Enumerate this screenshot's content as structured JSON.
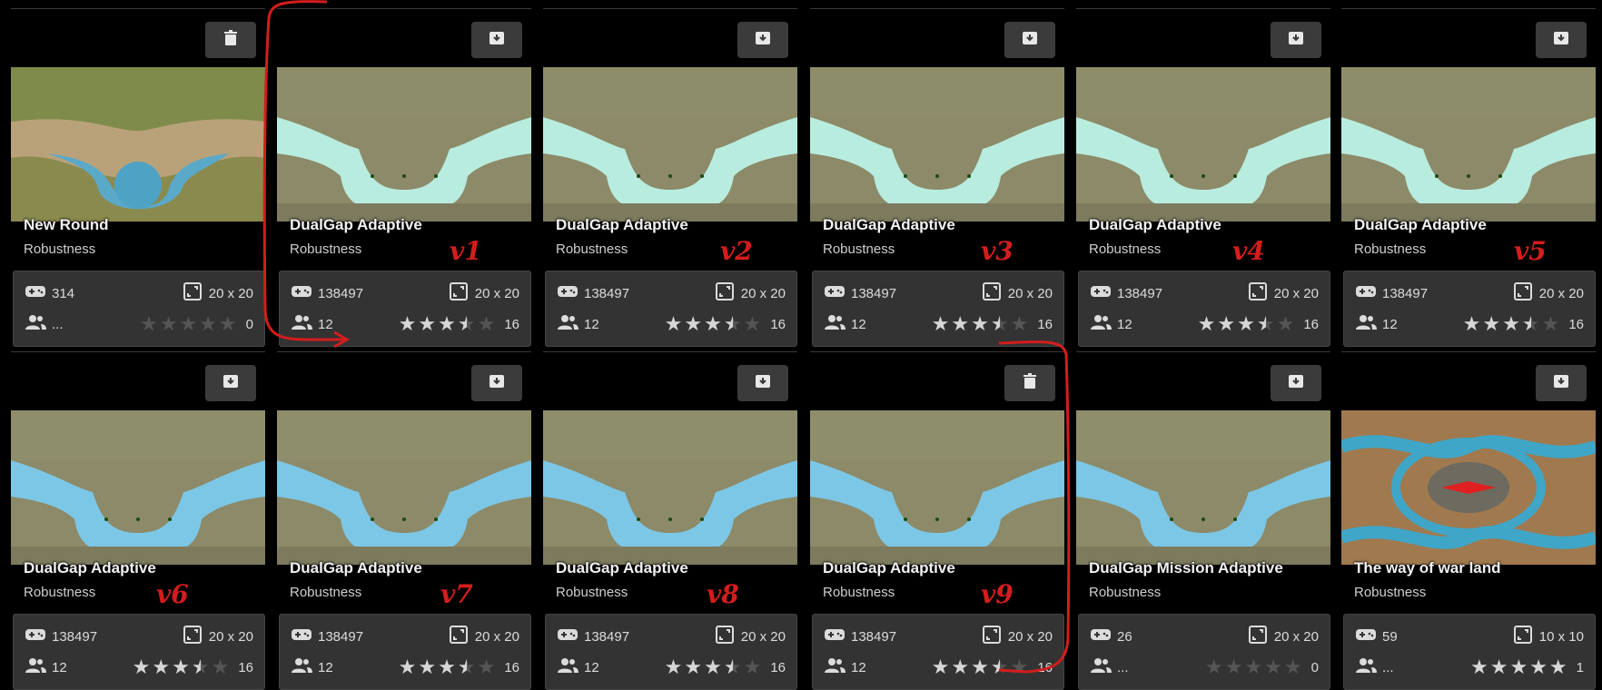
{
  "colors": {
    "page_bg": "#000000",
    "card_stats_bg": "#333333",
    "button_bg": "#3b3b3b",
    "annotation_red": "#d41d1d",
    "star_filled": "#d6d6d6",
    "star_empty": "#555555"
  },
  "cards": [
    {
      "title": "New Round",
      "subtitle": "Robustness",
      "plays": "314",
      "size": "20 x 20",
      "players": "...",
      "stars": 0,
      "rating_count": "0",
      "action": "delete",
      "version": "",
      "map": "sand"
    },
    {
      "title": "DualGap Adaptive",
      "subtitle": "Robustness",
      "plays": "138497",
      "size": "20 x 20",
      "players": "12",
      "stars": 3.5,
      "rating_count": "16",
      "action": "download",
      "version": "v1",
      "map": "river"
    },
    {
      "title": "DualGap Adaptive",
      "subtitle": "Robustness",
      "plays": "138497",
      "size": "20 x 20",
      "players": "12",
      "stars": 3.5,
      "rating_count": "16",
      "action": "download",
      "version": "v2",
      "map": "river"
    },
    {
      "title": "DualGap Adaptive",
      "subtitle": "Robustness",
      "plays": "138497",
      "size": "20 x 20",
      "players": "12",
      "stars": 3.5,
      "rating_count": "16",
      "action": "download",
      "version": "v3",
      "map": "river"
    },
    {
      "title": "DualGap Adaptive",
      "subtitle": "Robustness",
      "plays": "138497",
      "size": "20 x 20",
      "players": "12",
      "stars": 3.5,
      "rating_count": "16",
      "action": "download",
      "version": "v4",
      "map": "river"
    },
    {
      "title": "DualGap Adaptive",
      "subtitle": "Robustness",
      "plays": "138497",
      "size": "20 x 20",
      "players": "12",
      "stars": 3.5,
      "rating_count": "16",
      "action": "download",
      "version": "v5",
      "map": "river"
    },
    {
      "title": "DualGap Adaptive",
      "subtitle": "Robustness",
      "plays": "138497",
      "size": "20 x 20",
      "players": "12",
      "stars": 3.5,
      "rating_count": "16",
      "action": "download",
      "version": "v6",
      "map": "river2"
    },
    {
      "title": "DualGap Adaptive",
      "subtitle": "Robustness",
      "plays": "138497",
      "size": "20 x 20",
      "players": "12",
      "stars": 3.5,
      "rating_count": "16",
      "action": "download",
      "version": "v7",
      "map": "river2"
    },
    {
      "title": "DualGap Adaptive",
      "subtitle": "Robustness",
      "plays": "138497",
      "size": "20 x 20",
      "players": "12",
      "stars": 3.5,
      "rating_count": "16",
      "action": "download",
      "version": "v8",
      "map": "river2"
    },
    {
      "title": "DualGap Adaptive",
      "subtitle": "Robustness",
      "plays": "138497",
      "size": "20 x 20",
      "players": "12",
      "stars": 3.5,
      "rating_count": "16",
      "action": "delete",
      "version": "v9",
      "map": "river2"
    },
    {
      "title": "DualGap Mission Adaptive",
      "subtitle": "Robustness",
      "plays": "26",
      "size": "20 x 20",
      "players": "...",
      "stars": 0,
      "rating_count": "0",
      "action": "download",
      "version": "",
      "map": "river2"
    },
    {
      "title": "The way of war land",
      "subtitle": "Robustness",
      "plays": "59",
      "size": "10 x 10",
      "players": "...",
      "stars": 5,
      "rating_count": "1",
      "action": "download",
      "version": "",
      "map": "symmetric"
    }
  ]
}
